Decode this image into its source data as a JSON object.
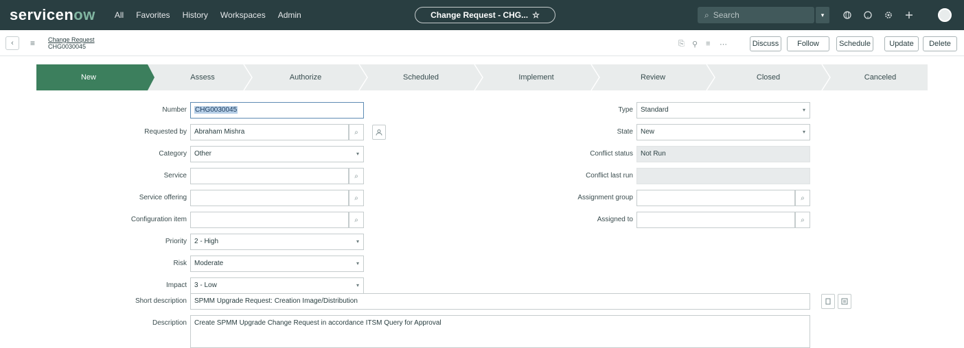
{
  "topnav": {
    "logo_main": "servicen",
    "logo_o": "ow",
    "links": [
      "All",
      "Favorites",
      "History",
      "Workspaces",
      "Admin"
    ],
    "context_pill": "Change Request - CHG...",
    "context_star": "☆",
    "search_placeholder": "Search",
    "search_icon": "⌕",
    "dropdown_icon": "▾",
    "icons": [
      "globe-icon",
      "help-icon",
      "settings-icon",
      "add-icon"
    ]
  },
  "form_header": {
    "back": "‹",
    "menu": "≡",
    "title_line1": "Change Request",
    "title_line2": "CHG0030045",
    "icons": [
      "⎘",
      "⚲",
      "≡",
      "⋯"
    ],
    "buttons": [
      "Discuss",
      "Follow",
      "Schedule",
      "Update",
      "Delete"
    ]
  },
  "stages": [
    "New",
    "Assess",
    "Authorize",
    "Scheduled",
    "Implement",
    "Review",
    "Closed",
    "Canceled"
  ],
  "left_fields": [
    {
      "label": "Number",
      "value": "CHG0030045",
      "kind": "focus"
    },
    {
      "label": "Requested by",
      "value": "Abraham Mishra",
      "kind": "lookup"
    },
    {
      "label": "Category",
      "value": "Other",
      "kind": "select"
    },
    {
      "label": "Service",
      "value": "",
      "kind": "lookup"
    },
    {
      "label": "Service offering",
      "value": "",
      "kind": "lookup"
    },
    {
      "label": "Configuration item",
      "value": "",
      "kind": "lookup"
    },
    {
      "label": "Priority",
      "value": "2 - High",
      "kind": "select"
    },
    {
      "label": "Risk",
      "value": "Moderate",
      "kind": "select"
    },
    {
      "label": "Impact",
      "value": "3 - Low",
      "kind": "select"
    }
  ],
  "right_fields": [
    {
      "label": "Type",
      "value": "Standard",
      "kind": "select"
    },
    {
      "label": "State",
      "value": "New",
      "kind": "select"
    },
    {
      "label": "Conflict status",
      "value": "Not Run",
      "kind": "readonly"
    },
    {
      "label": "Conflict last run",
      "value": "",
      "kind": "readonly"
    },
    {
      "label": "Assignment group",
      "value": "",
      "kind": "lookup"
    },
    {
      "label": "Assigned to",
      "value": "",
      "kind": "lookup"
    }
  ],
  "short_description": {
    "label": "Short description",
    "value": "SPMM Upgrade Request: Creation Image/Distribution"
  },
  "description": {
    "label": "Description",
    "value": "Create SPMM Upgrade Change Request in accordance ITSM Query for Approval"
  }
}
